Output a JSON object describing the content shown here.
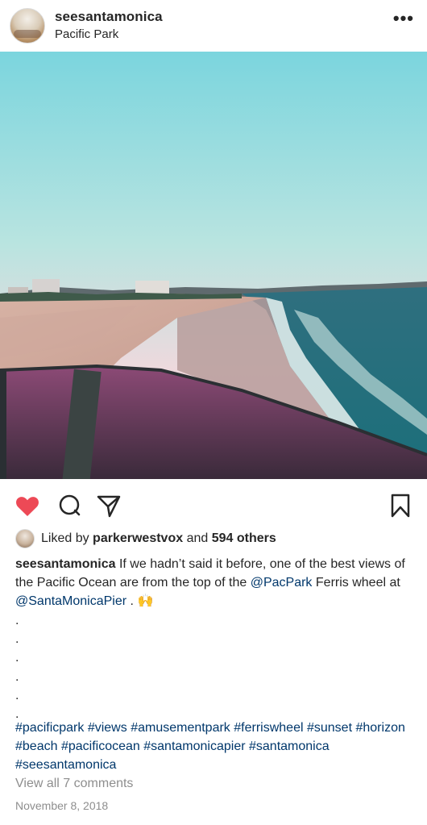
{
  "post": {
    "username": "seesantamonica",
    "location": "Pacific Park",
    "more_glyph": "•••",
    "likes": {
      "prefix": "Liked by",
      "liker": "parkerwestvox",
      "and": "and",
      "others": "594 others"
    },
    "caption": {
      "author": "seesantamonica",
      "text1": "If we hadn’t said it before, one of the best views of the Pacific Ocean are from the top of the",
      "mention1": "@PacPark",
      "text2": "Ferris wheel at",
      "mention2": "@SantaMonicaPier",
      "text3": ".",
      "emoji": "🙌"
    },
    "dots": [
      ".",
      ".",
      ".",
      ".",
      ".",
      "."
    ],
    "hashtags": [
      "#pacificpark",
      "#views",
      "#amusementpark",
      "#ferriswheel",
      "#sunset",
      "#horizon",
      "#beach",
      "#pacificocean",
      "#santamonicapier",
      "#santamonica",
      "#seesantamonica"
    ],
    "view_comments": "View all 7 comments",
    "date": "November 8, 2018",
    "colors": {
      "like_red": "#ed4956",
      "link_blue": "#00376b",
      "muted_gray": "#8e8e8e"
    }
  }
}
